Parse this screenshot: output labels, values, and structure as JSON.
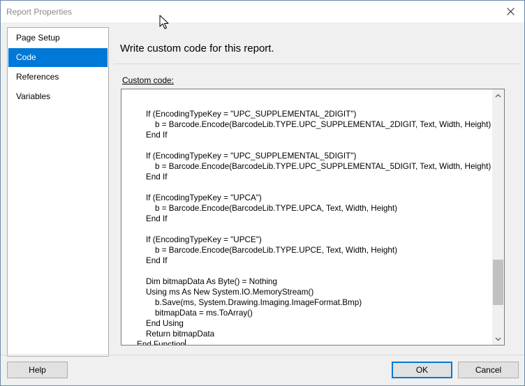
{
  "window": {
    "title": "Report Properties"
  },
  "nav": {
    "items": [
      {
        "label": "Page Setup",
        "selected": false
      },
      {
        "label": "Code",
        "selected": true
      },
      {
        "label": "References",
        "selected": false
      },
      {
        "label": "Variables",
        "selected": false
      }
    ]
  },
  "main": {
    "heading": "Write custom code for this report.",
    "code_label": "Custom code:",
    "code_lines": [
      "",
      "If (EncodingTypeKey = \"UPC_SUPPLEMENTAL_2DIGIT\")",
      "    b = Barcode.Encode(BarcodeLib.TYPE.UPC_SUPPLEMENTAL_2DIGIT, Text, Width, Height)",
      "End If",
      "",
      "If (EncodingTypeKey = \"UPC_SUPPLEMENTAL_5DIGIT\")",
      "    b = Barcode.Encode(BarcodeLib.TYPE.UPC_SUPPLEMENTAL_5DIGIT, Text, Width, Height)",
      "End If",
      "",
      "If (EncodingTypeKey = \"UPCA\")",
      "    b = Barcode.Encode(BarcodeLib.TYPE.UPCA, Text, Width, Height)",
      "End If",
      "",
      "If (EncodingTypeKey = \"UPCE\")",
      "    b = Barcode.Encode(BarcodeLib.TYPE.UPCE, Text, Width, Height)",
      "End If",
      "",
      "Dim bitmapData As Byte() = Nothing",
      "Using ms As New System.IO.MemoryStream()",
      "    b.Save(ms, System.Drawing.Imaging.ImageFormat.Bmp)",
      "    bitmapData = ms.ToArray()",
      "End Using",
      "Return bitmapData"
    ],
    "last_line": "End Function",
    "scroll_position": 0.85
  },
  "buttons": {
    "help": "Help",
    "ok": "OK",
    "cancel": "Cancel"
  },
  "icons": {
    "close": "close-icon",
    "cursor": "mouse-pointer-icon",
    "scroll_up": "chevron-up-icon",
    "scroll_down": "chevron-down-icon"
  },
  "colors": {
    "accent": "#0078d7"
  }
}
